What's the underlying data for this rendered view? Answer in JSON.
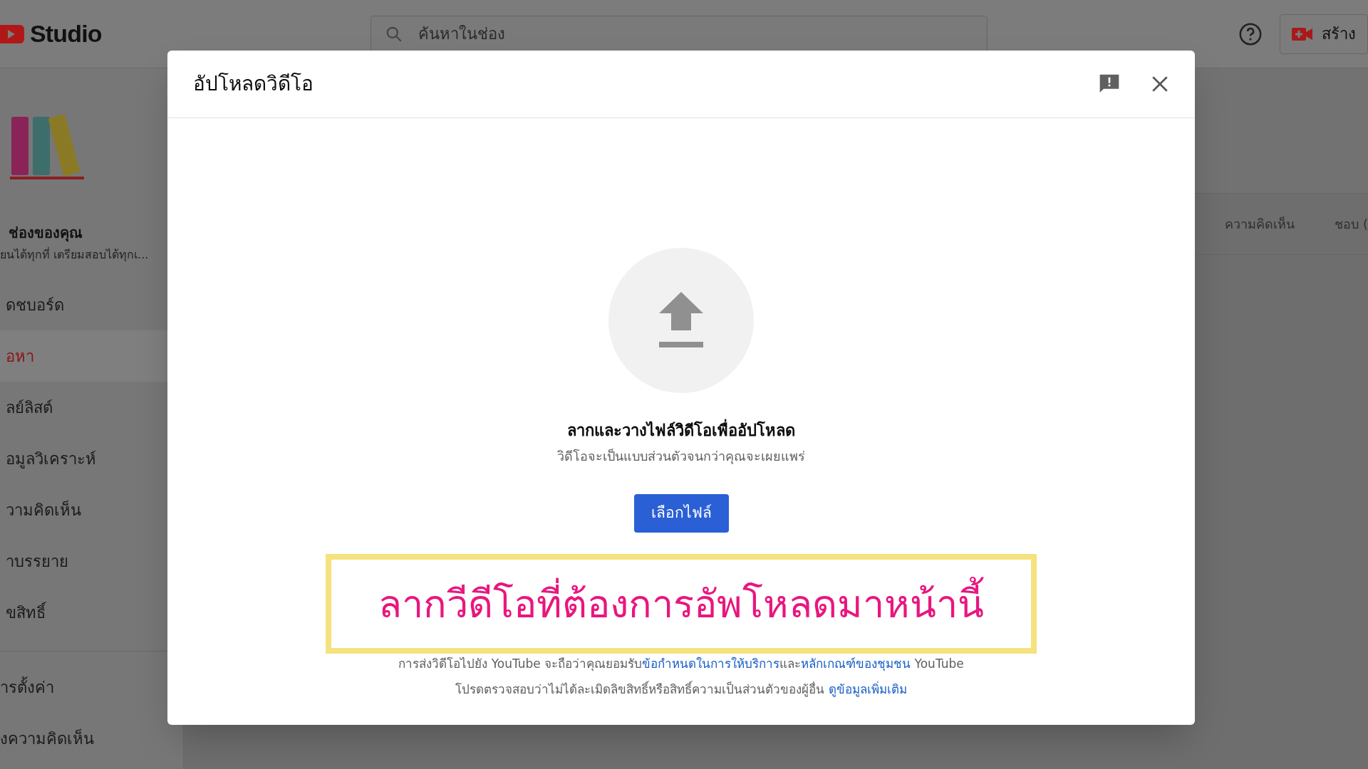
{
  "topbar": {
    "logo_text": "Studio",
    "search": {
      "placeholder": "ค้นหาในช่อง"
    },
    "create_button": "สร้าง"
  },
  "sidebar": {
    "channel_name": "ช่องของคุณ",
    "channel_subtitle": "ยนได้ทุกที่ เตรียมสอบได้ทุกเ...",
    "items": [
      {
        "label": "ดชบอร์ด",
        "selected": false
      },
      {
        "label": "อหา",
        "selected": true
      },
      {
        "label": "ลย์ลิสต์",
        "selected": false
      },
      {
        "label": "อมูลวิเคราะห์",
        "selected": false
      },
      {
        "label": "วามคิดเห็น",
        "selected": false
      },
      {
        "label": "าบรรยาย",
        "selected": false
      },
      {
        "label": "ขสิทธิ์",
        "selected": false
      }
    ],
    "bottom_items": [
      {
        "label": "ารตั้งค่า"
      },
      {
        "label": "งความคิดเห็น"
      }
    ]
  },
  "background_columns": [
    "ความคิดเห็น",
    "ชอบ ("
  ],
  "dialog": {
    "title": "อัปโหลดวิดีโอ",
    "drop_title": "ลากและวางไฟล์วิดีโอเพื่ออัปโหลด",
    "drop_subtitle": "วิดีโอจะเป็นแบบส่วนตัวจนกว่าคุณจะเผยแพร่",
    "select_button": "เลือกไฟล์",
    "annotation": "ลากวีดีโอที่ต้องการอัพโหลดมาหน้านี้",
    "footer_lines": [
      [
        {
          "kind": "text",
          "text": "การส่งวิดีโอไปยัง YouTube จะถือว่าคุณยอมรับ"
        },
        {
          "kind": "link",
          "text": "ข้อกำหนดในการให้บริการ"
        },
        {
          "kind": "text",
          "text": "และ"
        },
        {
          "kind": "link",
          "text": "หลักเกณฑ์ของชุมชน"
        },
        {
          "kind": "text",
          "text": " YouTube"
        }
      ],
      [
        {
          "kind": "text",
          "text": "โปรดตรวจสอบว่าไม่ได้ละเมิดลิขสิทธิ์หรือสิทธิ์ความเป็นส่วนตัวของผู้อื่น "
        },
        {
          "kind": "link",
          "text": "ดูข้อมูลเพิ่มเติม"
        }
      ]
    ]
  }
}
